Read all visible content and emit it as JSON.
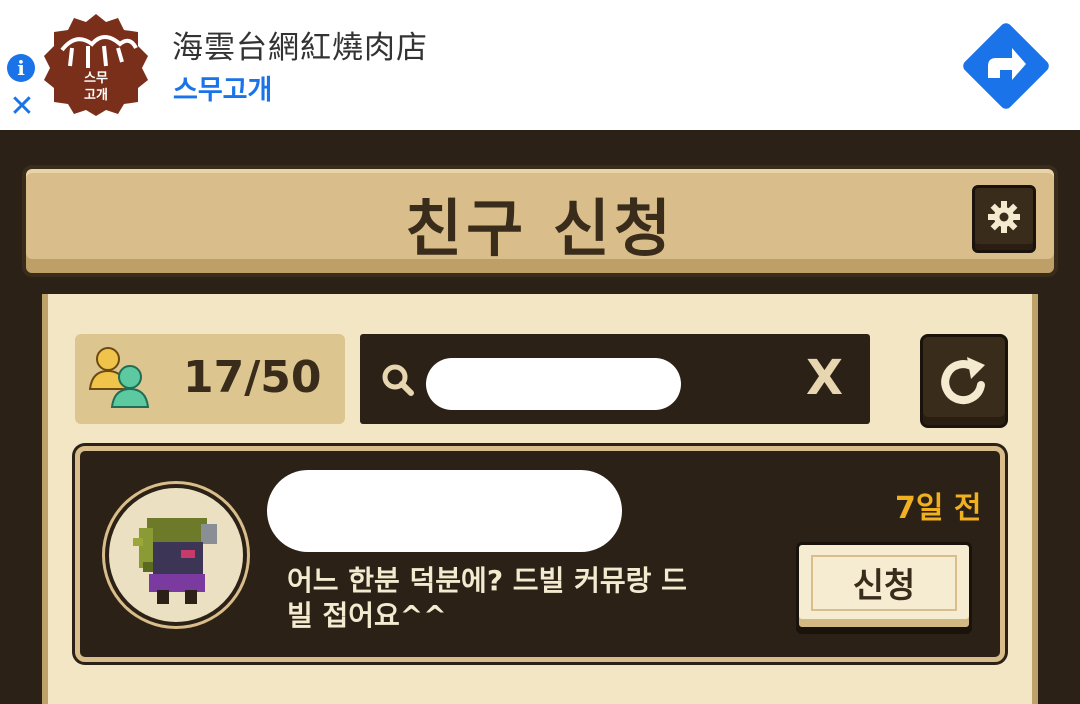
{
  "ad": {
    "title": "海雲台網紅燒肉店",
    "subtitle": "스무고개",
    "logo_text_line1": "스무",
    "logo_text_line2": "고개",
    "icons": [
      "info-icon",
      "close-icon",
      "directions-icon"
    ],
    "accent_color": "#1a73e8"
  },
  "header": {
    "title": "친구 신청",
    "settings_icon": "gear-icon"
  },
  "toolbar": {
    "friend_count": "17/50",
    "search_value": "",
    "clear_label": "X",
    "refresh_icon": "refresh-icon"
  },
  "requests": [
    {
      "name": "",
      "time": "7일 전",
      "message": "어느 한분 덕분에? 드빌 커뮤랑 드빌 접어요^^",
      "button_label": "신청"
    }
  ],
  "colors": {
    "panel_dark": "#2b2116",
    "panel_tan": "#d9bd8a",
    "panel_light": "#f2e6c4",
    "time_gold": "#f0b020"
  }
}
